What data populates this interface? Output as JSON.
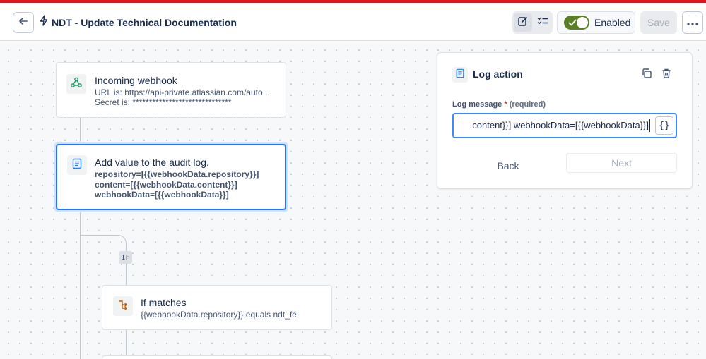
{
  "header": {
    "title": "NDT - Update Technical Documentation",
    "enabled_label": "Enabled",
    "save_label": "Save"
  },
  "nodes": {
    "trigger": {
      "title": "Incoming webhook",
      "line1": "URL is: https://api-private.atlassian.com/auto...",
      "line2": "Secret is: ******************************"
    },
    "audit": {
      "title": "Add value to the audit log.",
      "line1": "repository=[{{webhookData.repository}}]",
      "line2": "content=[{{webhookData.content}}]",
      "line3": "webhookData=[{{webhookData}}]"
    },
    "if_badge": "IF",
    "condition": {
      "title": "If matches",
      "line1": "{{webhookData.repository}} equals ndt_fe"
    }
  },
  "panel": {
    "title": "Log action",
    "field_label": "Log message",
    "required_mark": "*",
    "required_text": "(required)",
    "field_value": ".content}}] webhookData=[{{webhookData}}]",
    "var_button": "{}",
    "back_label": "Back",
    "next_label": "Next"
  },
  "colors": {
    "accent": "#1d7afc",
    "enabled_toggle": "#5b7f24",
    "top_stripe": "#e2111b"
  }
}
